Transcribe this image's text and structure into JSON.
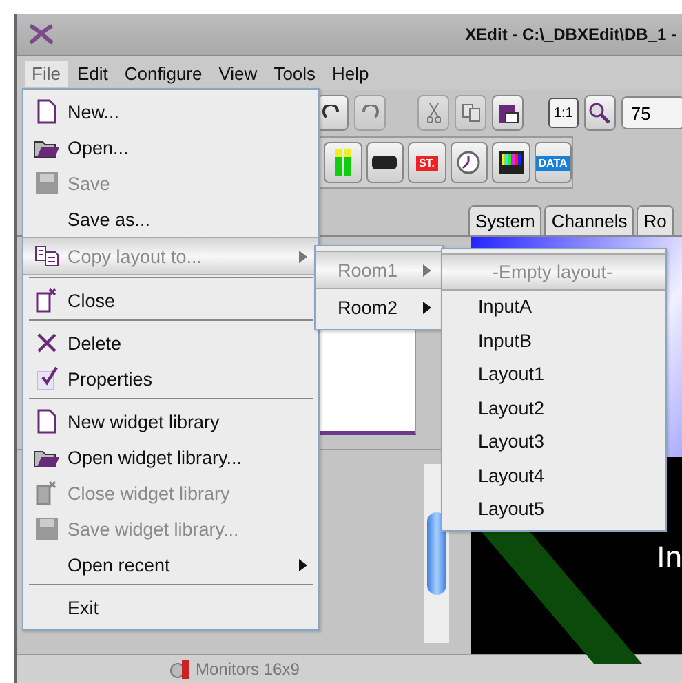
{
  "window": {
    "title": "XEdit - C:\\_DBXEdit\\DB_1 -"
  },
  "menubar": [
    {
      "label": "File",
      "selected": true
    },
    {
      "label": "Edit",
      "selected": false
    },
    {
      "label": "Configure",
      "selected": false
    },
    {
      "label": "View",
      "selected": false
    },
    {
      "label": "Tools",
      "selected": false
    },
    {
      "label": "Help",
      "selected": false
    }
  ],
  "toolbar": {
    "actual_size_label": "1:1",
    "zoom_value": "75",
    "widget_labels": [
      "ST.",
      "DATA"
    ]
  },
  "tabs": [
    {
      "label": "System",
      "selected": false
    },
    {
      "label": "Channels",
      "selected": false
    },
    {
      "label": "Ro",
      "selected": false
    }
  ],
  "file_menu": [
    {
      "kind": "item",
      "label": "New...",
      "disabled": false,
      "selected": false,
      "submenu": false
    },
    {
      "kind": "item",
      "label": "Open...",
      "disabled": false,
      "selected": false,
      "submenu": false
    },
    {
      "kind": "item",
      "label": "Save",
      "disabled": true,
      "selected": false,
      "submenu": false
    },
    {
      "kind": "item",
      "label": "Save as...",
      "disabled": false,
      "selected": false,
      "submenu": false
    },
    {
      "kind": "item",
      "label": "Copy layout to...",
      "disabled": true,
      "selected": true,
      "submenu": true
    },
    {
      "kind": "separator"
    },
    {
      "kind": "item",
      "label": "Close",
      "disabled": false,
      "selected": false,
      "submenu": false
    },
    {
      "kind": "separator"
    },
    {
      "kind": "item",
      "label": "Delete",
      "disabled": false,
      "selected": false,
      "submenu": false
    },
    {
      "kind": "item",
      "label": "Properties",
      "disabled": false,
      "selected": false,
      "submenu": false
    },
    {
      "kind": "separator"
    },
    {
      "kind": "item",
      "label": "New widget library",
      "disabled": false,
      "selected": false,
      "submenu": false
    },
    {
      "kind": "item",
      "label": "Open widget library...",
      "disabled": false,
      "selected": false,
      "submenu": false
    },
    {
      "kind": "item",
      "label": "Close widget library",
      "disabled": true,
      "selected": false,
      "submenu": false
    },
    {
      "kind": "item",
      "label": "Save widget library...",
      "disabled": true,
      "selected": false,
      "submenu": false
    },
    {
      "kind": "item",
      "label": "Open recent",
      "disabled": false,
      "selected": false,
      "submenu": true
    },
    {
      "kind": "separator"
    },
    {
      "kind": "item",
      "label": "Exit",
      "disabled": false,
      "selected": false,
      "submenu": false
    }
  ],
  "room_menu": [
    {
      "label": "Room1",
      "disabled": true,
      "selected": true,
      "submenu": true
    },
    {
      "label": "Room2",
      "disabled": false,
      "selected": false,
      "submenu": true
    }
  ],
  "layout_menu": [
    {
      "label": "-Empty layout-",
      "disabled": true,
      "selected": true
    },
    {
      "label": "InputA",
      "disabled": false,
      "selected": false
    },
    {
      "label": "InputB",
      "disabled": false,
      "selected": false
    },
    {
      "label": "Layout1",
      "disabled": false,
      "selected": false
    },
    {
      "label": "Layout2",
      "disabled": false,
      "selected": false
    },
    {
      "label": "Layout3",
      "disabled": false,
      "selected": false
    },
    {
      "label": "Layout4",
      "disabled": false,
      "selected": false
    },
    {
      "label": "Layout5",
      "disabled": false,
      "selected": false
    }
  ],
  "preview": {
    "caption": "In"
  },
  "status": {
    "label": "Monitors 16x9"
  }
}
